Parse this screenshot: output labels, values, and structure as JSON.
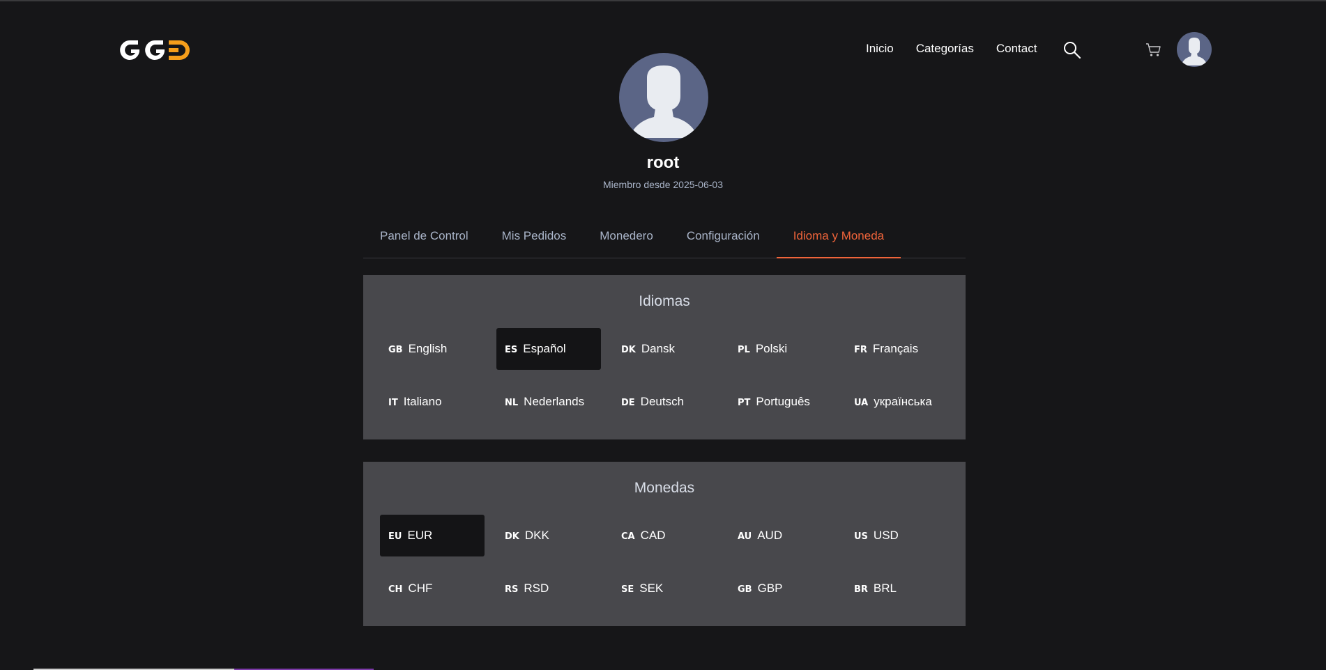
{
  "header": {
    "logo_icon": "ggd-logo",
    "brand_colors": {
      "white": "#ffffff",
      "orange": "#f59e1b"
    },
    "nav": [
      {
        "label": "Inicio"
      },
      {
        "label": "Categorías"
      },
      {
        "label": "Contact"
      }
    ],
    "icons": [
      "search-icon",
      "cart-icon",
      "user-avatar"
    ]
  },
  "profile": {
    "username": "root",
    "member_since": "Miembro desde 2025-06-03"
  },
  "tabs": [
    {
      "label": "Panel de Control",
      "active": false
    },
    {
      "label": "Mis Pedidos",
      "active": false
    },
    {
      "label": "Monedero",
      "active": false
    },
    {
      "label": "Configuración",
      "active": false
    },
    {
      "label": "Idioma y Moneda",
      "active": true
    }
  ],
  "accent_color": "#f0643a",
  "languages": {
    "title": "Idiomas",
    "options": [
      {
        "code": "GB",
        "label": "English",
        "selected": false
      },
      {
        "code": "ES",
        "label": "Español",
        "selected": true
      },
      {
        "code": "DK",
        "label": "Dansk",
        "selected": false
      },
      {
        "code": "PL",
        "label": "Polski",
        "selected": false
      },
      {
        "code": "FR",
        "label": "Français",
        "selected": false
      },
      {
        "code": "IT",
        "label": "Italiano",
        "selected": false
      },
      {
        "code": "NL",
        "label": "Nederlands",
        "selected": false
      },
      {
        "code": "DE",
        "label": "Deutsch",
        "selected": false
      },
      {
        "code": "PT",
        "label": "Português",
        "selected": false
      },
      {
        "code": "UA",
        "label": "українська",
        "selected": false
      }
    ]
  },
  "currencies": {
    "title": "Monedas",
    "options": [
      {
        "code": "EU",
        "label": "EUR",
        "selected": true
      },
      {
        "code": "DK",
        "label": "DKK",
        "selected": false
      },
      {
        "code": "CA",
        "label": "CAD",
        "selected": false
      },
      {
        "code": "AU",
        "label": "AUD",
        "selected": false
      },
      {
        "code": "US",
        "label": "USD",
        "selected": false
      },
      {
        "code": "CH",
        "label": "CHF",
        "selected": false
      },
      {
        "code": "RS",
        "label": "RSD",
        "selected": false
      },
      {
        "code": "SE",
        "label": "SEK",
        "selected": false
      },
      {
        "code": "GB",
        "label": "GBP",
        "selected": false
      },
      {
        "code": "BR",
        "label": "BRL",
        "selected": false
      }
    ]
  }
}
